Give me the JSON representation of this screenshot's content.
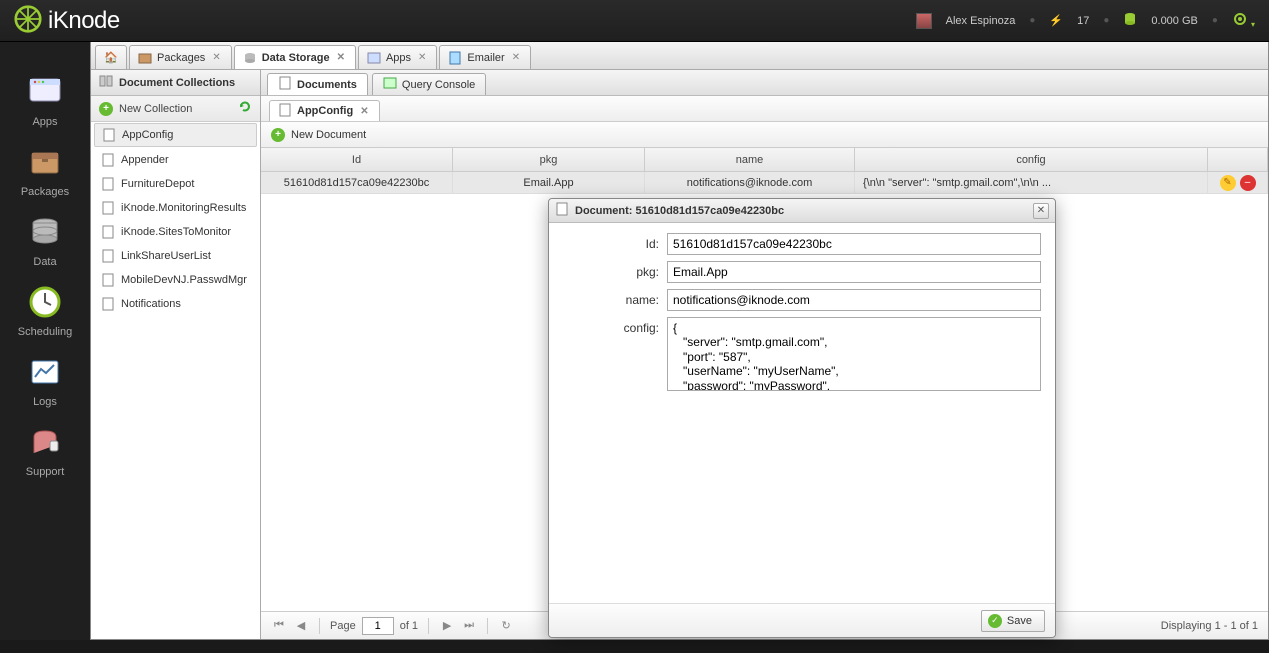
{
  "brand": "iKnode",
  "user": {
    "name": "Alex Espinoza",
    "bolts": "17",
    "storage": "0.000 GB"
  },
  "rail": [
    {
      "label": "Apps",
      "name": "rail-apps"
    },
    {
      "label": "Packages",
      "name": "rail-packages"
    },
    {
      "label": "Data",
      "name": "rail-data"
    },
    {
      "label": "Scheduling",
      "name": "rail-scheduling"
    },
    {
      "label": "Logs",
      "name": "rail-logs"
    },
    {
      "label": "Support",
      "name": "rail-support"
    }
  ],
  "tabs": {
    "packages": "Packages",
    "datastorage": "Data Storage",
    "apps": "Apps",
    "emailer": "Emailer"
  },
  "side": {
    "title": "Document Collections",
    "newcoll": "New Collection",
    "items": [
      "AppConfig",
      "Appender",
      "FurnitureDepot",
      "iKnode.MonitoringResults",
      "iKnode.SitesToMonitor",
      "LinkShareUserList",
      "MobileDevNJ.PasswdMgr",
      "Notifications"
    ]
  },
  "subtabs": {
    "documents": "Documents",
    "query": "Query Console"
  },
  "doctab": "AppConfig",
  "newdoc": "New Document",
  "columns": {
    "id": "Id",
    "pkg": "pkg",
    "name": "name",
    "config": "config"
  },
  "row": {
    "id": "51610d81d157ca09e42230bc",
    "pkg": "Email.App",
    "name": "notifications@iknode.com",
    "config": "{\\n\\n  \"server\": \"smtp.gmail.com\",\\n\\n ..."
  },
  "pager": {
    "page_lbl": "Page",
    "page": "1",
    "of": "of 1",
    "status": "Displaying 1 - 1 of 1"
  },
  "docwin": {
    "title_prefix": "Document: ",
    "title_id": "51610d81d157ca09e42230bc",
    "labels": {
      "id": "Id:",
      "pkg": "pkg:",
      "name": "name:",
      "config": "config:"
    },
    "values": {
      "id": "51610d81d157ca09e42230bc",
      "pkg": "Email.App",
      "name": "notifications@iknode.com",
      "config": "{\n   \"server\": \"smtp.gmail.com\",\n   \"port\": \"587\",\n   \"userName\": \"myUserName\",\n   \"password\": \"myPassword\","
    },
    "save": "Save"
  }
}
